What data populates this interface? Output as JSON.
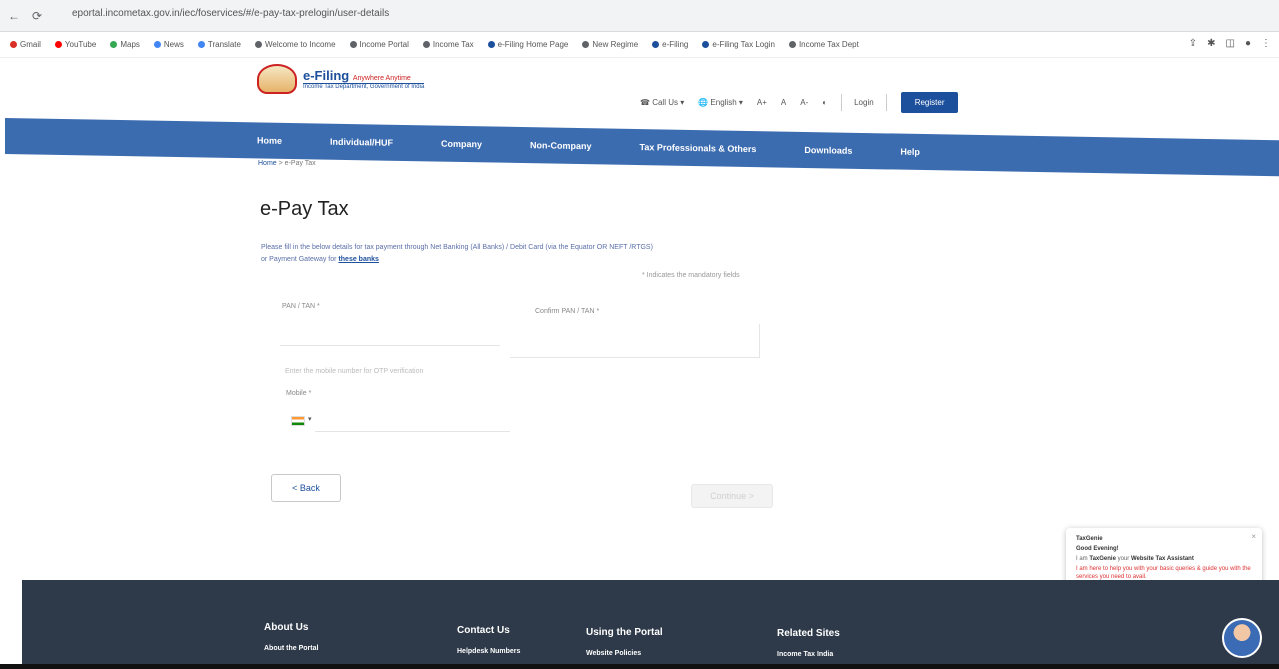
{
  "browser": {
    "url": "eportal.incometax.gov.in/iec/foservices/#/e-pay-tax-prelogin/user-details"
  },
  "bookmarks": [
    {
      "label": "Gmail",
      "color": "#d93025"
    },
    {
      "label": "YouTube",
      "color": "#ff0000"
    },
    {
      "label": "Maps",
      "color": "#34a853"
    },
    {
      "label": "News",
      "color": "#4285f4"
    },
    {
      "label": "Translate",
      "color": "#4285f4"
    },
    {
      "label": "Welcome to Income",
      "color": "#5f6368"
    },
    {
      "label": "Income Portal",
      "color": "#5f6368"
    },
    {
      "label": "Income Tax",
      "color": "#5f6368"
    },
    {
      "label": "e-Filing Home Page",
      "color": "#1c4f9c"
    },
    {
      "label": "New Regime",
      "color": "#5f6368"
    },
    {
      "label": "e-Filing",
      "color": "#1c4f9c"
    },
    {
      "label": "e-Filing Tax Login",
      "color": "#1c4f9c"
    },
    {
      "label": "Income Tax Dept",
      "color": "#5f6368"
    }
  ],
  "header": {
    "logo_title": "e-Filing",
    "logo_tagline": "Anywhere Anytime",
    "logo_sub": "Income Tax Department, Government of India",
    "call_us": "Call Us",
    "language": "English",
    "font_increase": "A+",
    "font_normal": "A",
    "font_decrease": "A-",
    "login": "Login",
    "register": "Register"
  },
  "nav": [
    "Home",
    "Individual/HUF",
    "Company",
    "Non-Company",
    "Tax Professionals & Others",
    "Downloads",
    "Help"
  ],
  "breadcrumb": {
    "home": "Home",
    "current": "e-Pay Tax"
  },
  "page": {
    "title": "e-Pay Tax",
    "instructions": "Please fill in the below details for tax payment through Net Banking (All Banks) / Debit Card (via the Equator OR NEFT /RTGS)",
    "instructions_2": "or Payment Gateway for",
    "instructions_link": "these banks",
    "mandatory_note": "* Indicates the mandatory fields"
  },
  "form": {
    "pan_label": "PAN / TAN *",
    "confirm_label": "Confirm PAN / TAN *",
    "otp_note": "Enter the mobile number for OTP verification",
    "mobile_label": "Mobile *",
    "back_label": "< Back",
    "continue_label": "Continue >"
  },
  "chat": {
    "name": "TaxGenie",
    "greeting": "Good Evening!",
    "line_prefix": "I am",
    "assistant_name": "TaxGenie",
    "line_mid": "your",
    "assistant_role": "Website Tax Assistant",
    "message": "I am here to help you with your basic queries & guide you with the services you need to avail."
  },
  "footer": {
    "about": {
      "heading": "About Us",
      "link": "About the Portal"
    },
    "contact": {
      "heading": "Contact Us",
      "link": "Helpdesk Numbers"
    },
    "using": {
      "heading": "Using the Portal",
      "link": "Website Policies"
    },
    "related": {
      "heading": "Related Sites",
      "link": "Income Tax India"
    }
  }
}
